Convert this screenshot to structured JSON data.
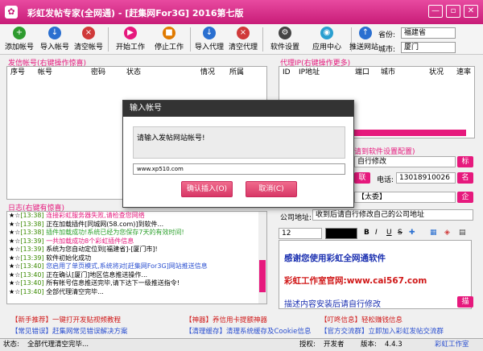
{
  "window": {
    "title": "彩虹发帖专家(全网通) - [赶集网For3G]    2016第七版",
    "min": "—",
    "restore": "▫",
    "close": "✕"
  },
  "toolbar": [
    {
      "label": "添加帐号",
      "color": "#2e9b2e",
      "glyph": "+"
    },
    {
      "label": "导入帐号",
      "color": "#2a6fd0",
      "glyph": "↓"
    },
    {
      "label": "清空帐号",
      "color": "#d03a3a",
      "glyph": "×"
    },
    {
      "label": "开始工作",
      "color": "#e6197d",
      "glyph": "▶"
    },
    {
      "label": "停止工作",
      "color": "#e07a00",
      "glyph": "■"
    },
    {
      "label": "导入代理",
      "color": "#2a6fd0",
      "glyph": "↓"
    },
    {
      "label": "清空代理",
      "color": "#d03a3a",
      "glyph": "×"
    },
    {
      "label": "软件设置",
      "color": "#444444",
      "glyph": "⚙"
    },
    {
      "label": "应用中心",
      "color": "#2a9fd0",
      "glyph": "◉"
    },
    {
      "label": "推送网站",
      "color": "#2a6fd0",
      "glyph": "↑"
    }
  ],
  "location": {
    "province_label": "省份:",
    "province": "福建省",
    "city_label": "城市:",
    "city": "厦门"
  },
  "accounts": {
    "section": "发信帐号(右键操作惊喜)",
    "columns": [
      "序号",
      "帐号",
      "密码",
      "状态",
      "情况",
      "所属"
    ]
  },
  "proxies": {
    "section": "代理IP(右键操作更多)",
    "columns": [
      "ID",
      "IP地址",
      "端口",
      "城市",
      "状况",
      "速率"
    ]
  },
  "dialog": {
    "title": "输入帐号",
    "prompt": "请输入发帖网站帐号!",
    "value": "www.xp510.com",
    "confirm": "确认插入(O)",
    "cancel": "取消(C)"
  },
  "log": {
    "section": "日志(右键有惊喜)",
    "lines": [
      {
        "star": "★☆",
        "time": "[13:38]",
        "text": "连接彩虹服务器失败,请检查您网络",
        "color": "#e6197d"
      },
      {
        "star": "★☆",
        "time": "[13:38]",
        "text": "正在加载插件[同城网(58.com)]到软件...",
        "color": "#000000"
      },
      {
        "star": "★☆",
        "time": "[13:38]",
        "text": "插件加载成功!系统已经为您保存7天的有效时间!",
        "color": "#2a9f2a"
      },
      {
        "star": "★☆",
        "time": "[13:39]",
        "text": "一共加载成功8个彩虹插件信息",
        "color": "#e6197d"
      },
      {
        "star": "★☆",
        "time": "[13:39]",
        "text": "系统为您自动定位到[福建省]-[厦门市]!",
        "color": "#000000"
      },
      {
        "star": "★☆",
        "time": "[13:39]",
        "text": "软件初始化成功",
        "color": "#000000"
      },
      {
        "star": "★☆",
        "time": "[13:40]",
        "text": "您启用了单页模式,系统将对[赶集网For3G]网站推送信息",
        "color": "#2a4fd0"
      },
      {
        "star": "★☆",
        "time": "[13:40]",
        "text": "正在确认[厦门]地区信息推送操作...",
        "color": "#000000"
      },
      {
        "star": "★☆",
        "time": "[13:40]",
        "text": "所有帐号信息推送完毕,请下达下一级推送指令!",
        "color": "#000000"
      },
      {
        "star": "★☆",
        "time": "[13:40]",
        "text": "全部代理清空完毕...",
        "color": "#000000"
      }
    ]
  },
  "settings": {
    "section": "请到软件设置配置)",
    "content_value": "自行修改",
    "tag1": "标",
    "contact_prefix": "联",
    "phone_label": "电话:",
    "phone": "13018910026",
    "tag2": "名",
    "name": "【太委】",
    "tag3": "企",
    "address_label": "公司地址:",
    "address": "收到后请自行修改自己的公司地址",
    "font_size": "12"
  },
  "promo": {
    "line1": "感谢您使用彩虹全网通软件",
    "line2": "彩虹工作室官网:www.cai567.com",
    "line3": "描述内容安装后请自行修改",
    "tag": "描"
  },
  "links": [
    {
      "text": "【新手推荐】一键打开发贴视频教程",
      "color": "#d01818"
    },
    {
      "text": "【神器】养信用卡提额神器",
      "color": "#d01818"
    },
    {
      "text": "【叮咚信息】轻松赚钱信息",
      "color": "#d01818"
    },
    {
      "text": "【常见错误】赶集网常见错误解决方案",
      "color": "#2a4fd0"
    },
    {
      "text": "【清理缓存】清理系统缓存及Cookie信息",
      "color": "#2a4fd0"
    },
    {
      "text": "【官方交流群】立即加入彩虹发帖交流群",
      "color": "#2a4fd0"
    }
  ],
  "status": {
    "label": "状态:",
    "message": "全部代理清空完毕...",
    "auth_label": "授权:",
    "auth": "开发者",
    "ver_label": "版本:",
    "version": "4.4.3",
    "studio": "彩虹工作室"
  }
}
